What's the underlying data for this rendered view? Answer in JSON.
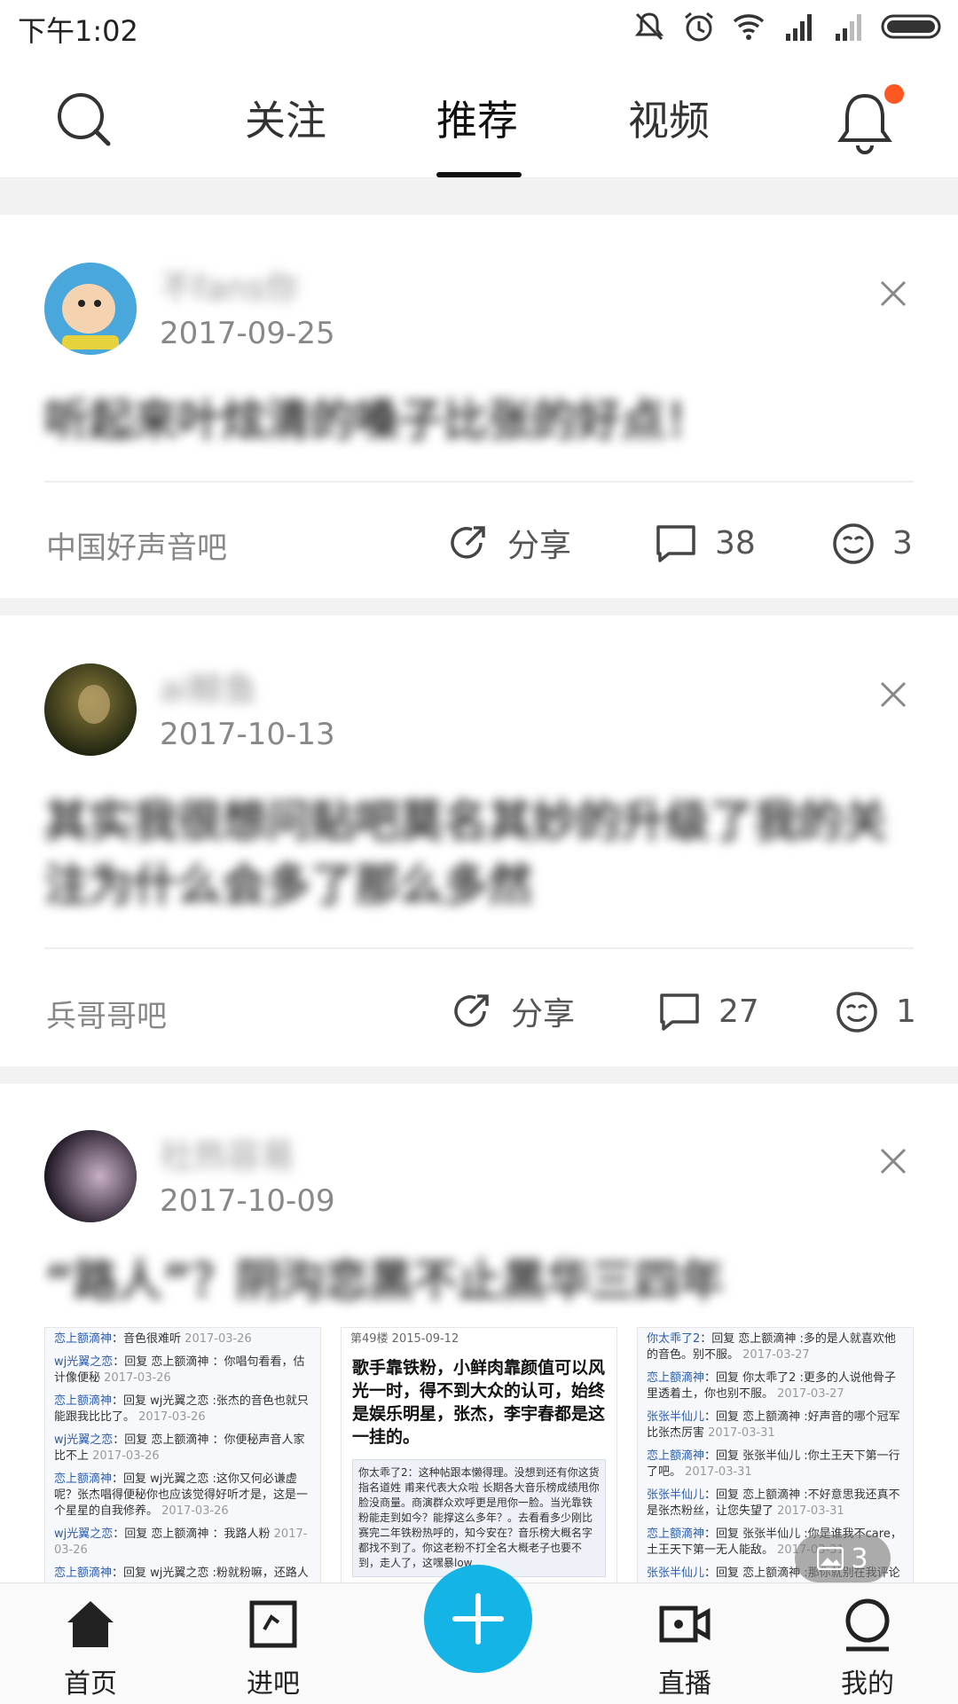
{
  "status_bar": {
    "time": "下午1:02"
  },
  "top_nav": {
    "tabs": [
      {
        "label": "关注"
      },
      {
        "label": "推荐",
        "active": true
      },
      {
        "label": "视频"
      }
    ]
  },
  "posts": [
    {
      "username": "不fans你",
      "date": "2017-09-25",
      "title": "听起来叶炫清的嗓子比张的好点！",
      "forum": "中国好声音吧",
      "share_label": "分享",
      "comments": "38",
      "likes": "3"
    },
    {
      "username": "ai鲸鱼",
      "date": "2017-10-13",
      "title": "其实我很想问贴吧莫名其妙的升级了我的关注为什么会多了那么多然",
      "forum": "兵哥哥吧",
      "share_label": "分享",
      "comments": "27",
      "likes": "1"
    },
    {
      "username": "社热容易",
      "date": "2017-10-09",
      "title": "“路人”？阴沟恋黑不止黑华三四年",
      "image_count": "3",
      "images": [
        {
          "lines": [
            {
              "user": "恋上额滴神",
              "text": "：音色很难听",
              "time": "2017-03-26"
            },
            {
              "user": "wj光翼之恋",
              "text": "：回复 恋上额滴神 ：你唱句看看，估计像便秘",
              "time": "2017-03-26"
            },
            {
              "user": "恋上额滴神",
              "text": "：回复 wj光翼之恋 :张杰的音色也就只能跟我比比了。",
              "time": "2017-03-26"
            },
            {
              "user": "wj光翼之恋",
              "text": "：回复 恋上额滴神 ：你便秘声音人家比不上",
              "time": "2017-03-26"
            },
            {
              "user": "恋上额滴神",
              "text": "：回复 wj光翼之恋 :这你又何必谦虚呢？张杰唱得便秘你也应该觉得好听才是，这是一个星星的自我修养。",
              "time": "2017-03-26"
            },
            {
              "user": "wj光翼之恋",
              "text": "：回复 恋上额滴神 ：我路人粉",
              "time": "2017-03-26"
            },
            {
              "user": "恋上额滴神",
              "text": "：回复 wj光翼之恋 :粉就粉嘛，还路人",
              "time": ""
            }
          ]
        },
        {
          "header": "第49楼  2015-09-12",
          "big_text": "歌手靠铁粉，小鲜肉靠颜值可以风光一时，得不到大众的认可，始终是娱乐明星，张杰，李宇春都是这一挂的。",
          "quote": "你太乖了2：这种帖跟本懒得理。没想到还有你这货指名道姓 甫来代表大众啦 长期各大音乐榜成绩甩你脸没商量。商演群众欢呼更是甩你一脸。当光靠铁粉能走到如今？能撑这么多年？。去看看多少刚比赛完二年铁粉热呼的，知今安在？音乐榜大概名字都找不到了。你这老粉不打全名大概老子也要不到，走人了，这嘿暴low"
        },
        {
          "lines": [
            {
              "user": "你太乖了2",
              "text": "：回复 恋上额滴神 :多的是人就喜欢他的音色。别不服。",
              "time": "2017-03-27"
            },
            {
              "user": "恋上额滴神",
              "text": "：回复 你太乖了2 :更多的人说他骨子里透着土，你也别不服。",
              "time": "2017-03-27"
            },
            {
              "user": "张张半仙儿",
              "text": "：回复 恋上额滴神 :好声音的哪个冠军比张杰厉害",
              "time": "2017-03-31"
            },
            {
              "user": "恋上额滴神",
              "text": "：回复 张张半仙儿 :你土王天下第一行了吧。",
              "time": "2017-03-31"
            },
            {
              "user": "张张半仙儿",
              "text": "：回复 恋上额滴神 :不好意思我还真不是张杰粉丝，让您失望了",
              "time": "2017-03-31"
            },
            {
              "user": "恋上额滴神",
              "text": "：回复 张张半仙儿 :你是谁我不care，土王天下第一无人能敌。",
              "time": "2017-03-31"
            },
            {
              "user": "张张半仙儿",
              "text": "：回复 恋上额滴神 :那你就别在我评论里",
              "time": ""
            }
          ]
        }
      ]
    }
  ],
  "bottom_nav": [
    {
      "label": "首页"
    },
    {
      "label": "进吧"
    },
    {
      "label": "直播"
    },
    {
      "label": "我的"
    }
  ],
  "colors": {
    "accent": "#14b4e6",
    "badge": "#ff5722"
  }
}
